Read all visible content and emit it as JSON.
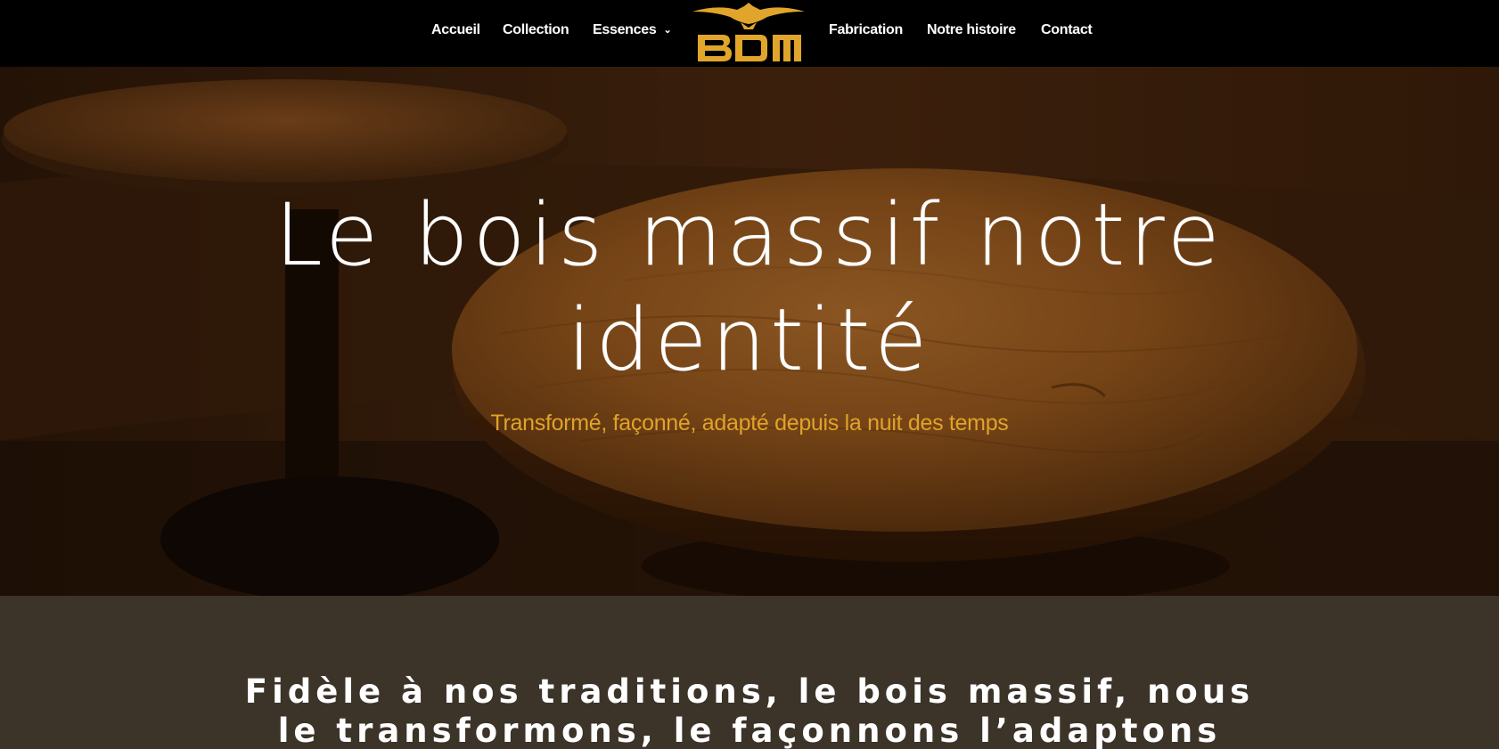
{
  "nav": {
    "items": [
      {
        "label": "Accueil"
      },
      {
        "label": "Collection"
      },
      {
        "label": "Essences",
        "has_dropdown": true
      },
      {
        "label": "Fabrication"
      },
      {
        "label": "Notre histoire"
      },
      {
        "label": "Contact"
      }
    ],
    "logo": {
      "text": "BDM",
      "icon": "eagle-logo",
      "color": "#e0a52a"
    }
  },
  "hero": {
    "title_line1": "Le bois massif notre",
    "title_line2": "identité",
    "subtitle": "Transformé, façonné, adapté depuis la nuit des temps",
    "subtitle_color": "#e0a32a"
  },
  "story": {
    "line1": "Fidèle à nos traditions, le bois massif, nous",
    "line2": "le transformons, le façonnons l’adaptons"
  }
}
